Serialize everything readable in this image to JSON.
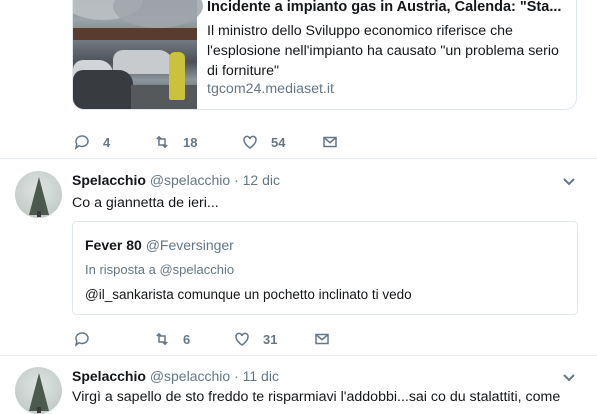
{
  "link_card": {
    "title": "Incidente a impianto gas in Austria, Calenda: \"Sta...",
    "description": "Il ministro dello Sviluppo economico riferisce che l'esplosione nell'impianto ha causato \"un problema serio di forniture\"",
    "domain": "tgcom24.mediaset.it"
  },
  "tweet0_actions": {
    "replies": "4",
    "retweets": "18",
    "likes": "54"
  },
  "tweet1": {
    "name": "Spelacchio",
    "handle": "@spelacchio",
    "date": "· 12 dic",
    "text": "Co a giannetta de ieri...",
    "quote": {
      "name": "Fever 80",
      "handle": "@Feversinger",
      "reply_prefix": "In risposta a ",
      "reply_to": "@spelacchio",
      "text": "@il_sankarista comunque un pochetto inclinato ti vedo"
    },
    "actions": {
      "replies": "",
      "retweets": "6",
      "likes": "31"
    }
  },
  "tweet2": {
    "name": "Spelacchio",
    "handle": "@spelacchio",
    "date": "· 11 dic",
    "text": "Virgì a sapello de sto freddo te risparmiavi l'addobbi...sai co du stalattiti, come"
  },
  "icons": [
    "reply-icon",
    "retweet-icon",
    "like-icon",
    "message-icon",
    "chevron-down-icon"
  ],
  "colors": {
    "text": "#14171a",
    "secondary": "#657786",
    "border": "#e1e8ed"
  }
}
